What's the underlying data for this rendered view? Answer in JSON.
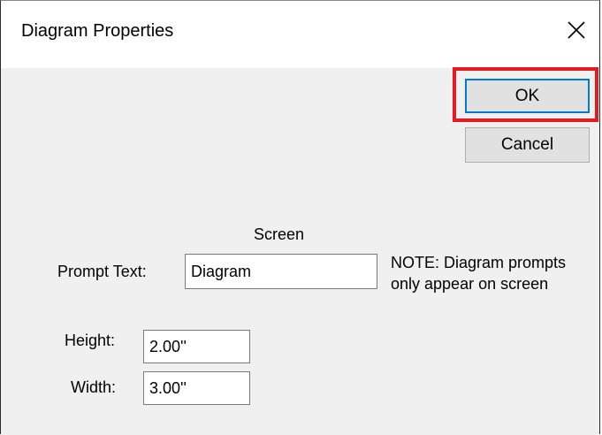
{
  "window": {
    "title": "Diagram Properties",
    "close_icon": "close-icon"
  },
  "buttons": {
    "ok_label": "OK",
    "cancel_label": "Cancel"
  },
  "form": {
    "section_label": "Screen",
    "prompt_label": "Prompt Text:",
    "prompt_value": "Diagram",
    "note_line1": "NOTE: Diagram prompts",
    "note_line2": "only appear on screen",
    "height_label": "Height:",
    "height_value": "2.00''",
    "width_label": "Width:",
    "width_value": "3.00''"
  },
  "colors": {
    "highlight": "#e41b23",
    "focus_border": "#0078d7"
  }
}
